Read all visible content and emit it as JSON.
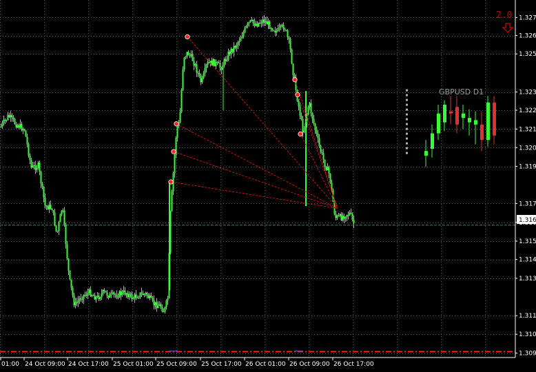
{
  "colors": {
    "background": "#000000",
    "grid": "#4a5a5a",
    "bull_candle": "#33ff33",
    "bear_candle": "#e03030",
    "bid_line": "#3a8a5a",
    "fan_lines": "#cc1010",
    "markers": "#ff2020",
    "dash_line": "#ff2020",
    "text": "#ffffff",
    "inset_title": "#9a9a9a"
  },
  "indicator": {
    "label": "2.0",
    "arrow_icon": "down-arrow-icon"
  },
  "inset": {
    "title": "GBPUSD D1"
  },
  "chart_data": {
    "type": "candlestick",
    "symbol": "GBPUSD",
    "ylim": [
      1.3087,
      1.3278
    ],
    "y_ticks": [
      "1.327",
      "1.326",
      "1.325",
      "1.323",
      "1.322",
      "1.321",
      "1.320",
      "1.319",
      "1.317",
      "1.316",
      "1.315",
      "1.314",
      "1.313",
      "1.311",
      "1.310",
      "1.309"
    ],
    "y_tick_values": [
      1.32704,
      1.3261,
      1.32514,
      1.32315,
      1.3222,
      1.32122,
      1.32025,
      1.31927,
      1.31733,
      1.31635,
      1.31537,
      1.31441,
      1.31343,
      1.31148,
      1.31051,
      1.30953
    ],
    "x_ticks": [
      "01:00",
      "24 Oct 09:00",
      "24 Oct 17:00",
      "25 Oct 01:00",
      "25 Oct 09:00",
      "25 Oct 17:00",
      "26 Oct 01:00",
      "26 Oct 09:00",
      "26 Oct 17:00"
    ],
    "current_price": {
      "label": "1.316",
      "value": 1.3162
    },
    "dashed_level": 1.3096,
    "path_points": [
      [
        0,
        1.3213
      ],
      [
        12,
        1.3219
      ],
      [
        22,
        1.3215
      ],
      [
        35,
        1.3212
      ],
      [
        45,
        1.3192
      ],
      [
        55,
        1.3193
      ],
      [
        65,
        1.3172
      ],
      [
        75,
        1.3171
      ],
      [
        82,
        1.3157
      ],
      [
        90,
        1.3172
      ],
      [
        100,
        1.3134
      ],
      [
        108,
        1.312
      ],
      [
        118,
        1.3125
      ],
      [
        130,
        1.3127
      ],
      [
        140,
        1.3124
      ],
      [
        150,
        1.3127
      ],
      [
        160,
        1.3125
      ],
      [
        172,
        1.3126
      ],
      [
        182,
        1.3127
      ],
      [
        192,
        1.3124
      ],
      [
        202,
        1.3126
      ],
      [
        212,
        1.3126
      ],
      [
        222,
        1.3121
      ],
      [
        232,
        1.312
      ],
      [
        238,
        1.3117
      ],
      [
        243,
        1.3124
      ],
      [
        247,
        1.3168
      ],
      [
        252,
        1.3194
      ],
      [
        256,
        1.3213
      ],
      [
        260,
        1.3215
      ],
      [
        266,
        1.325
      ],
      [
        272,
        1.3252
      ],
      [
        280,
        1.3248
      ],
      [
        292,
        1.3236
      ],
      [
        300,
        1.3246
      ],
      [
        310,
        1.3247
      ],
      [
        320,
        1.3244
      ],
      [
        332,
        1.3252
      ],
      [
        342,
        1.3256
      ],
      [
        352,
        1.3262
      ],
      [
        362,
        1.3268
      ],
      [
        372,
        1.3267
      ],
      [
        382,
        1.3269
      ],
      [
        392,
        1.3266
      ],
      [
        402,
        1.3263
      ],
      [
        412,
        1.3266
      ],
      [
        420,
        1.3256
      ],
      [
        425,
        1.3242
      ],
      [
        432,
        1.3226
      ],
      [
        440,
        1.321
      ],
      [
        448,
        1.3226
      ],
      [
        455,
        1.3215
      ],
      [
        463,
        1.3203
      ],
      [
        470,
        1.3195
      ],
      [
        478,
        1.3188
      ],
      [
        486,
        1.3166
      ],
      [
        494,
        1.3166
      ],
      [
        502,
        1.3168
      ],
      [
        508,
        1.3168
      ],
      [
        512,
        1.3163
      ]
    ],
    "markers": [
      {
        "bar": 272,
        "price": 1.32603
      },
      {
        "bar": 428,
        "price": 1.32379
      },
      {
        "bar": 432,
        "price": 1.32301
      },
      {
        "bar": 436,
        "price": 1.32096
      },
      {
        "bar": 256,
        "price": 1.32149
      },
      {
        "bar": 252,
        "price": 1.32004
      },
      {
        "bar": 248,
        "price": 1.31846
      }
    ],
    "fan_lines": [
      {
        "from": [
          272,
          1.32603
        ],
        "to": [
          490,
          1.31708
        ]
      },
      {
        "from": [
          428,
          1.32379
        ],
        "to": [
          490,
          1.31708
        ]
      },
      {
        "from": [
          432,
          1.32301
        ],
        "to": [
          490,
          1.31708
        ]
      },
      {
        "from": [
          436,
          1.32096
        ],
        "to": [
          490,
          1.31708
        ]
      },
      {
        "from": [
          256,
          1.32149
        ],
        "to": [
          490,
          1.31708
        ]
      },
      {
        "from": [
          252,
          1.32004
        ],
        "to": [
          490,
          1.31708
        ]
      },
      {
        "from": [
          248,
          1.31846
        ],
        "to": [
          490,
          1.31708
        ]
      }
    ],
    "inset_candles": [
      {
        "o": 1.31989,
        "c": 1.3201,
        "h": 1.3206,
        "l": 1.3194
      },
      {
        "o": 1.3202,
        "c": 1.3209,
        "h": 1.3213,
        "l": 1.3198
      },
      {
        "o": 1.3209,
        "c": 1.3218,
        "h": 1.3222,
        "l": 1.3206
      },
      {
        "o": 1.3214,
        "c": 1.3222,
        "h": 1.3224,
        "l": 1.321
      },
      {
        "o": 1.3219,
        "c": 1.3218,
        "h": 1.3226,
        "l": 1.3213
      },
      {
        "o": 1.3221,
        "c": 1.3213,
        "h": 1.3226,
        "l": 1.3209
      },
      {
        "o": 1.3216,
        "c": 1.3218,
        "h": 1.3222,
        "l": 1.3211
      },
      {
        "o": 1.3214,
        "c": 1.3216,
        "h": 1.322,
        "l": 1.3208
      },
      {
        "o": 1.3213,
        "c": 1.3215,
        "h": 1.3219,
        "l": 1.3204
      },
      {
        "o": 1.3213,
        "c": 1.3206,
        "h": 1.3219,
        "l": 1.3201
      },
      {
        "o": 1.3206,
        "c": 1.3223,
        "h": 1.3226,
        "l": 1.3203
      },
      {
        "o": 1.3223,
        "c": 1.3208,
        "h": 1.3226,
        "l": 1.3204
      }
    ]
  }
}
